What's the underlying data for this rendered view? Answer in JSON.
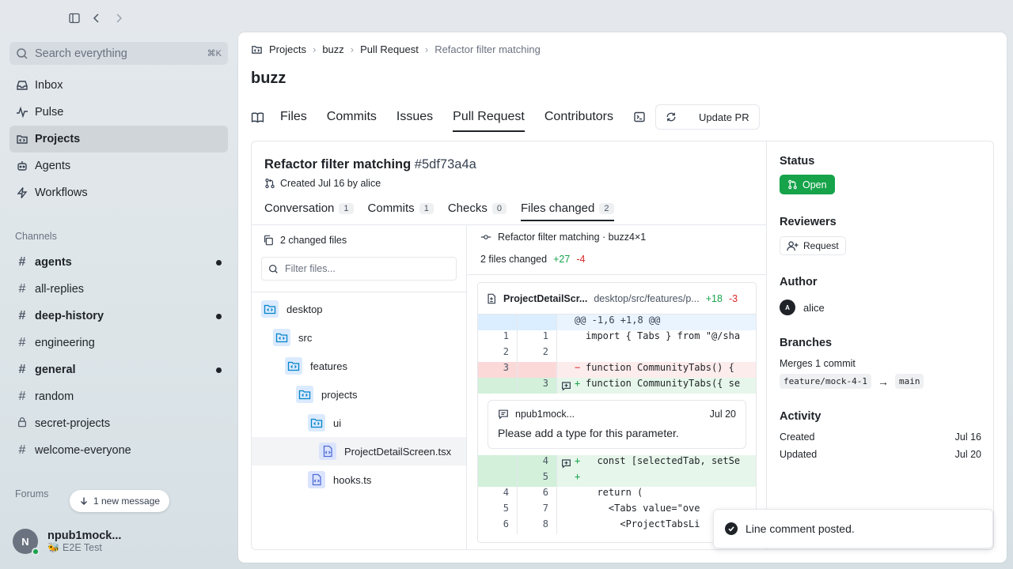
{
  "sidebar": {
    "search": {
      "placeholder": "Search everything",
      "shortcut": "⌘K"
    },
    "nav": [
      {
        "label": "Inbox",
        "icon": "inbox-icon"
      },
      {
        "label": "Pulse",
        "icon": "pulse-icon"
      },
      {
        "label": "Projects",
        "icon": "projects-icon",
        "active": true
      },
      {
        "label": "Agents",
        "icon": "agents-icon"
      },
      {
        "label": "Workflows",
        "icon": "workflows-icon"
      }
    ],
    "channels_label": "Channels",
    "channels": [
      {
        "label": "agents",
        "unread": true
      },
      {
        "label": "all-replies",
        "unread": false
      },
      {
        "label": "deep-history",
        "unread": true
      },
      {
        "label": "engineering",
        "unread": false
      },
      {
        "label": "general",
        "unread": true
      },
      {
        "label": "random",
        "unread": false
      },
      {
        "label": "secret-projects",
        "unread": false,
        "locked": true
      },
      {
        "label": "welcome-everyone",
        "unread": false
      }
    ],
    "forums_label": "Forums",
    "new_message": "1 new message",
    "user": {
      "initial": "N",
      "name": "npub1mock...",
      "status": "🐝 E2E Test"
    }
  },
  "breadcrumb": [
    "Projects",
    "buzz",
    "Pull Request",
    "Refactor filter matching"
  ],
  "repo_title": "buzz",
  "tabs": [
    "Files",
    "Commits",
    "Issues",
    "Pull Request",
    "Contributors"
  ],
  "update_pr": "Update PR",
  "pr": {
    "title": "Refactor filter matching",
    "hash": "#5df73a4a",
    "meta": "Created Jul 16 by alice",
    "subtabs": [
      {
        "label": "Conversation",
        "count": "1"
      },
      {
        "label": "Commits",
        "count": "1"
      },
      {
        "label": "Checks",
        "count": "0"
      },
      {
        "label": "Files changed",
        "count": "2"
      }
    ]
  },
  "files": {
    "header": "2 changed files",
    "filter_placeholder": "Filter files...",
    "tree": [
      {
        "label": "desktop",
        "depth": 0,
        "type": "folder"
      },
      {
        "label": "src",
        "depth": 1,
        "type": "folder"
      },
      {
        "label": "features",
        "depth": 2,
        "type": "folder"
      },
      {
        "label": "projects",
        "depth": 3,
        "type": "folder"
      },
      {
        "label": "ui",
        "depth": 4,
        "type": "folder"
      },
      {
        "label": "ProjectDetailScreen.tsx",
        "depth": 5,
        "type": "file",
        "selected": true
      },
      {
        "label": "hooks.ts",
        "depth": 4,
        "type": "file"
      }
    ]
  },
  "diff": {
    "commit": "Refactor filter matching · buzz4×1",
    "summary": "2 files changed",
    "additions": "+27",
    "deletions": "-4",
    "file": {
      "name": "ProjectDetailScr...",
      "path": "desktop/src/features/p...",
      "additions": "+18",
      "deletions": "-3"
    },
    "hunk": "@@ -1,6 +1,8 @@",
    "lines_top": [
      {
        "type": "ctx",
        "old": "1",
        "new": "1",
        "sign": "",
        "code": "import { Tabs } from \"@/sha"
      },
      {
        "type": "ctx",
        "old": "2",
        "new": "2",
        "sign": "",
        "code": ""
      },
      {
        "type": "rm",
        "old": "3",
        "new": "",
        "sign": "−",
        "code": "function CommunityTabs() {"
      },
      {
        "type": "ad",
        "old": "",
        "new": "3",
        "sign": "+",
        "code": "function CommunityTabs({ se"
      }
    ],
    "comment": {
      "author": "npub1mock...",
      "date": "Jul 20",
      "body": "Please add a type for this parameter."
    },
    "lines_bottom": [
      {
        "type": "ad",
        "old": "",
        "new": "4",
        "sign": "+",
        "code": "  const [selectedTab, setSe"
      },
      {
        "type": "ad",
        "old": "",
        "new": "5",
        "sign": "+",
        "code": ""
      },
      {
        "type": "ctx",
        "old": "4",
        "new": "6",
        "sign": "",
        "code": "  return ("
      },
      {
        "type": "ctx",
        "old": "5",
        "new": "7",
        "sign": "",
        "code": "    <Tabs value=\"ove"
      },
      {
        "type": "ctx",
        "old": "6",
        "new": "8",
        "sign": "",
        "code": "      <ProjectTabsLi"
      }
    ]
  },
  "side": {
    "status_label": "Status",
    "status_value": "Open",
    "reviewers_label": "Reviewers",
    "request": "Request",
    "author_label": "Author",
    "author_initial": "A",
    "author": "alice",
    "branches_label": "Branches",
    "merges": "Merges 1 commit",
    "from_branch": "feature/mock-4-1",
    "arrow": "→",
    "to_branch": "main",
    "activity_label": "Activity",
    "created_label": "Created",
    "created": "Jul 16",
    "updated_label": "Updated",
    "updated": "Jul 20"
  },
  "toast": "Line comment posted.",
  "colors": {
    "accent_green": "#16a34a",
    "delete_red": "#dc2626",
    "folder_blue": "#0284c7"
  }
}
